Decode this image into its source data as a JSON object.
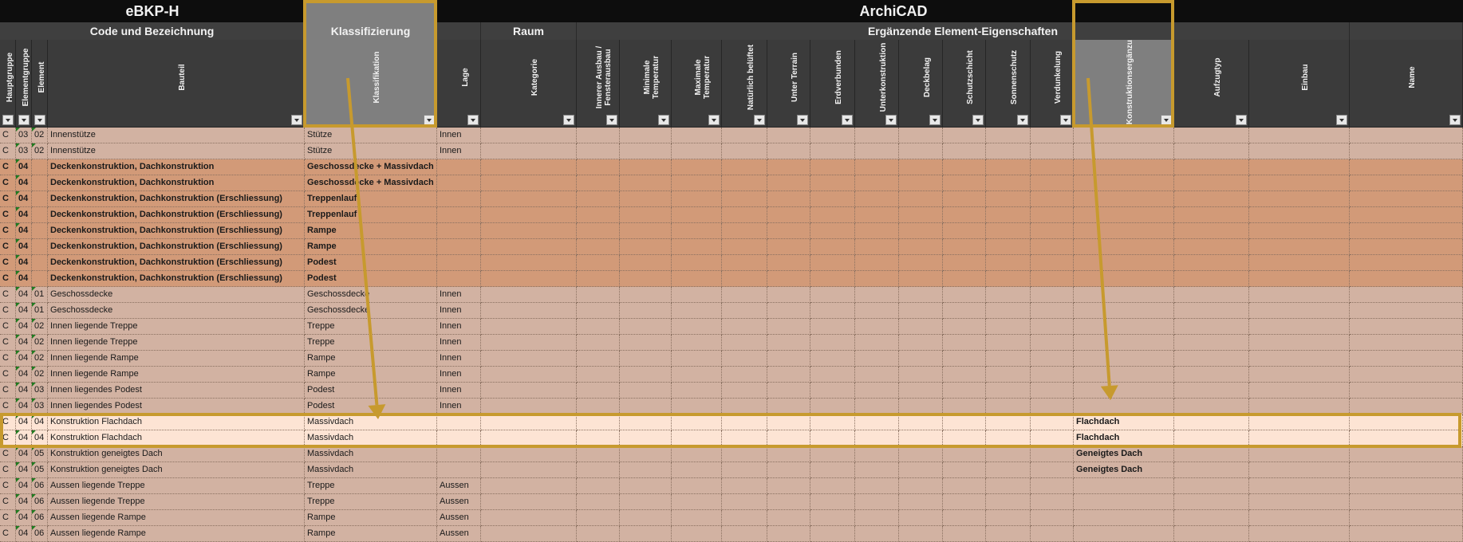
{
  "header": {
    "group_ebkp": "eBKP-H",
    "group_archicad": "ArchiCAD"
  },
  "subheaders": {
    "code": "Code und Bezeichnung",
    "klass": "Klassifizierung",
    "raum": "Raum",
    "erg": "Ergänzende Element-Eigenschaften"
  },
  "columns": [
    {
      "label": "Hauptgruppe"
    },
    {
      "label": "Elementgruppe"
    },
    {
      "label": "Element"
    },
    {
      "label": "Bauteil"
    },
    {
      "label": "Klassifikation"
    },
    {
      "label": "Lage"
    },
    {
      "label": "Kategorie"
    },
    {
      "label": "Innerer Ausbau / Fensterausbau"
    },
    {
      "label": "Minimale Temperatur"
    },
    {
      "label": "Maximale Temperatur"
    },
    {
      "label": "Natürlich belüftet"
    },
    {
      "label": "Unter Terrain"
    },
    {
      "label": "Erdverbunden"
    },
    {
      "label": "Unterkonstruktion"
    },
    {
      "label": "Deckbelag"
    },
    {
      "label": "Schutzschicht"
    },
    {
      "label": "Sonnenschutz"
    },
    {
      "label": "Verdunkelung"
    },
    {
      "label": "Konstruktionsergänzung"
    },
    {
      "label": "Aufzugtyp"
    },
    {
      "label": "Einbau"
    },
    {
      "label": "Name"
    }
  ],
  "rows": [
    {
      "hg": "C",
      "eg": "03",
      "el": "02",
      "bauteil": "Innenstütze",
      "klass": "Stütze",
      "lage": "Innen",
      "konst": "",
      "bold": false
    },
    {
      "hg": "C",
      "eg": "03",
      "el": "02",
      "bauteil": "Innenstütze",
      "klass": "Stütze",
      "lage": "Innen",
      "konst": "",
      "bold": false
    },
    {
      "hg": "C",
      "eg": "04",
      "el": "",
      "bauteil": "Deckenkonstruktion, Dachkonstruktion",
      "klass": "Geschossdecke + Massivdach",
      "lage": "",
      "konst": "",
      "bold": true
    },
    {
      "hg": "C",
      "eg": "04",
      "el": "",
      "bauteil": "Deckenkonstruktion, Dachkonstruktion",
      "klass": "Geschossdecke + Massivdach",
      "lage": "",
      "konst": "",
      "bold": true
    },
    {
      "hg": "C",
      "eg": "04",
      "el": "",
      "bauteil": "Deckenkonstruktion, Dachkonstruktion (Erschliessung)",
      "klass": "Treppenlauf",
      "lage": "",
      "konst": "",
      "bold": true
    },
    {
      "hg": "C",
      "eg": "04",
      "el": "",
      "bauteil": "Deckenkonstruktion, Dachkonstruktion (Erschliessung)",
      "klass": "Treppenlauf",
      "lage": "",
      "konst": "",
      "bold": true
    },
    {
      "hg": "C",
      "eg": "04",
      "el": "",
      "bauteil": "Deckenkonstruktion, Dachkonstruktion (Erschliessung)",
      "klass": "Rampe",
      "lage": "",
      "konst": "",
      "bold": true
    },
    {
      "hg": "C",
      "eg": "04",
      "el": "",
      "bauteil": "Deckenkonstruktion, Dachkonstruktion (Erschliessung)",
      "klass": "Rampe",
      "lage": "",
      "konst": "",
      "bold": true
    },
    {
      "hg": "C",
      "eg": "04",
      "el": "",
      "bauteil": "Deckenkonstruktion, Dachkonstruktion (Erschliessung)",
      "klass": "Podest",
      "lage": "",
      "konst": "",
      "bold": true
    },
    {
      "hg": "C",
      "eg": "04",
      "el": "",
      "bauteil": "Deckenkonstruktion, Dachkonstruktion (Erschliessung)",
      "klass": "Podest",
      "lage": "",
      "konst": "",
      "bold": true
    },
    {
      "hg": "C",
      "eg": "04",
      "el": "01",
      "bauteil": "Geschossdecke",
      "klass": "Geschossdecke",
      "lage": "Innen",
      "konst": "",
      "bold": false
    },
    {
      "hg": "C",
      "eg": "04",
      "el": "01",
      "bauteil": "Geschossdecke",
      "klass": "Geschossdecke",
      "lage": "Innen",
      "konst": "",
      "bold": false
    },
    {
      "hg": "C",
      "eg": "04",
      "el": "02",
      "bauteil": "Innen liegende Treppe",
      "klass": "Treppe",
      "lage": "Innen",
      "konst": "",
      "bold": false
    },
    {
      "hg": "C",
      "eg": "04",
      "el": "02",
      "bauteil": "Innen liegende Treppe",
      "klass": "Treppe",
      "lage": "Innen",
      "konst": "",
      "bold": false
    },
    {
      "hg": "C",
      "eg": "04",
      "el": "02",
      "bauteil": "Innen liegende  Rampe",
      "klass": "Rampe",
      "lage": "Innen",
      "konst": "",
      "bold": false
    },
    {
      "hg": "C",
      "eg": "04",
      "el": "02",
      "bauteil": "Innen liegende  Rampe",
      "klass": "Rampe",
      "lage": "Innen",
      "konst": "",
      "bold": false
    },
    {
      "hg": "C",
      "eg": "04",
      "el": "03",
      "bauteil": "Innen liegendes Podest",
      "klass": "Podest",
      "lage": "Innen",
      "konst": "",
      "bold": false
    },
    {
      "hg": "C",
      "eg": "04",
      "el": "03",
      "bauteil": "Innen liegendes Podest",
      "klass": "Podest",
      "lage": "Innen",
      "konst": "",
      "bold": false
    },
    {
      "hg": "C",
      "eg": "04",
      "el": "04",
      "bauteil": "Konstruktion Flachdach",
      "klass": "Massivdach",
      "lage": "",
      "konst": "Flachdach",
      "bold": false,
      "hl": true
    },
    {
      "hg": "C",
      "eg": "04",
      "el": "04",
      "bauteil": "Konstruktion Flachdach",
      "klass": "Massivdach",
      "lage": "",
      "konst": "Flachdach",
      "bold": false,
      "hl": true
    },
    {
      "hg": "C",
      "eg": "04",
      "el": "05",
      "bauteil": "Konstruktion geneigtes Dach",
      "klass": "Massivdach",
      "lage": "",
      "konst": "Geneigtes Dach",
      "bold": false
    },
    {
      "hg": "C",
      "eg": "04",
      "el": "05",
      "bauteil": "Konstruktion geneigtes Dach",
      "klass": "Massivdach",
      "lage": "",
      "konst": "Geneigtes Dach",
      "bold": false
    },
    {
      "hg": "C",
      "eg": "04",
      "el": "06",
      "bauteil": "Aussen liegende Treppe",
      "klass": "Treppe",
      "lage": "Aussen",
      "konst": "",
      "bold": false
    },
    {
      "hg": "C",
      "eg": "04",
      "el": "06",
      "bauteil": "Aussen liegende Treppe",
      "klass": "Treppe",
      "lage": "Aussen",
      "konst": "",
      "bold": false
    },
    {
      "hg": "C",
      "eg": "04",
      "el": "06",
      "bauteil": "Aussen liegende Rampe",
      "klass": "Rampe",
      "lage": "Aussen",
      "konst": "",
      "bold": false
    },
    {
      "hg": "C",
      "eg": "04",
      "el": "06",
      "bauteil": "Aussen liegende Rampe",
      "klass": "Rampe",
      "lage": "Aussen",
      "konst": "",
      "bold": false
    }
  ],
  "colors": {
    "row_normal": "#d2b2a2",
    "row_bold": "#d29a78",
    "row_highlight": "#fde4d4",
    "highlight_border": "#c79a2e",
    "header_dark": "#0d0d0d",
    "header_mid": "#3f3f3f",
    "header_selected": "#7f7f7f"
  },
  "icons": [
    "filter-dropdown-icon",
    "comment-indicator-icon",
    "arrow-down-icon"
  ]
}
